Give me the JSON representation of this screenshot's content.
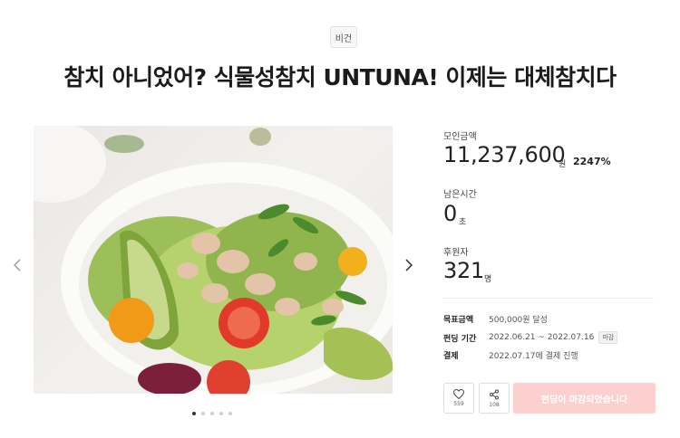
{
  "category": "비건",
  "title": "참치 아니었어? 식물성참치 UNTUNA! 이제는 대체참치다",
  "funding": {
    "amount_label": "모인금액",
    "amount": "11,237,600",
    "amount_unit": "원",
    "rate": "2247%",
    "time_label": "남은시간",
    "time_value": "0",
    "time_unit": "초",
    "backers_label": "후원자",
    "backers": "321",
    "backers_unit": "명"
  },
  "details": {
    "goal_key": "목표금액",
    "goal_val": "500,000원 달성",
    "period_key": "펀딩 기간",
    "period_val": "2022.06.21 ~ 2022.07.16",
    "period_badge": "마감",
    "payment_key": "결제",
    "payment_val": "2022.07.17에 결제 진행"
  },
  "actions": {
    "like_count": "559",
    "share_count": "108",
    "fund_label": "펀딩이 마감되었습니다"
  },
  "carousel": {
    "slide_count": 5,
    "active_index": 0
  },
  "icons": {
    "prev": "chevron-left-icon",
    "next": "chevron-right-icon",
    "like": "heart-icon",
    "share": "share-icon"
  }
}
